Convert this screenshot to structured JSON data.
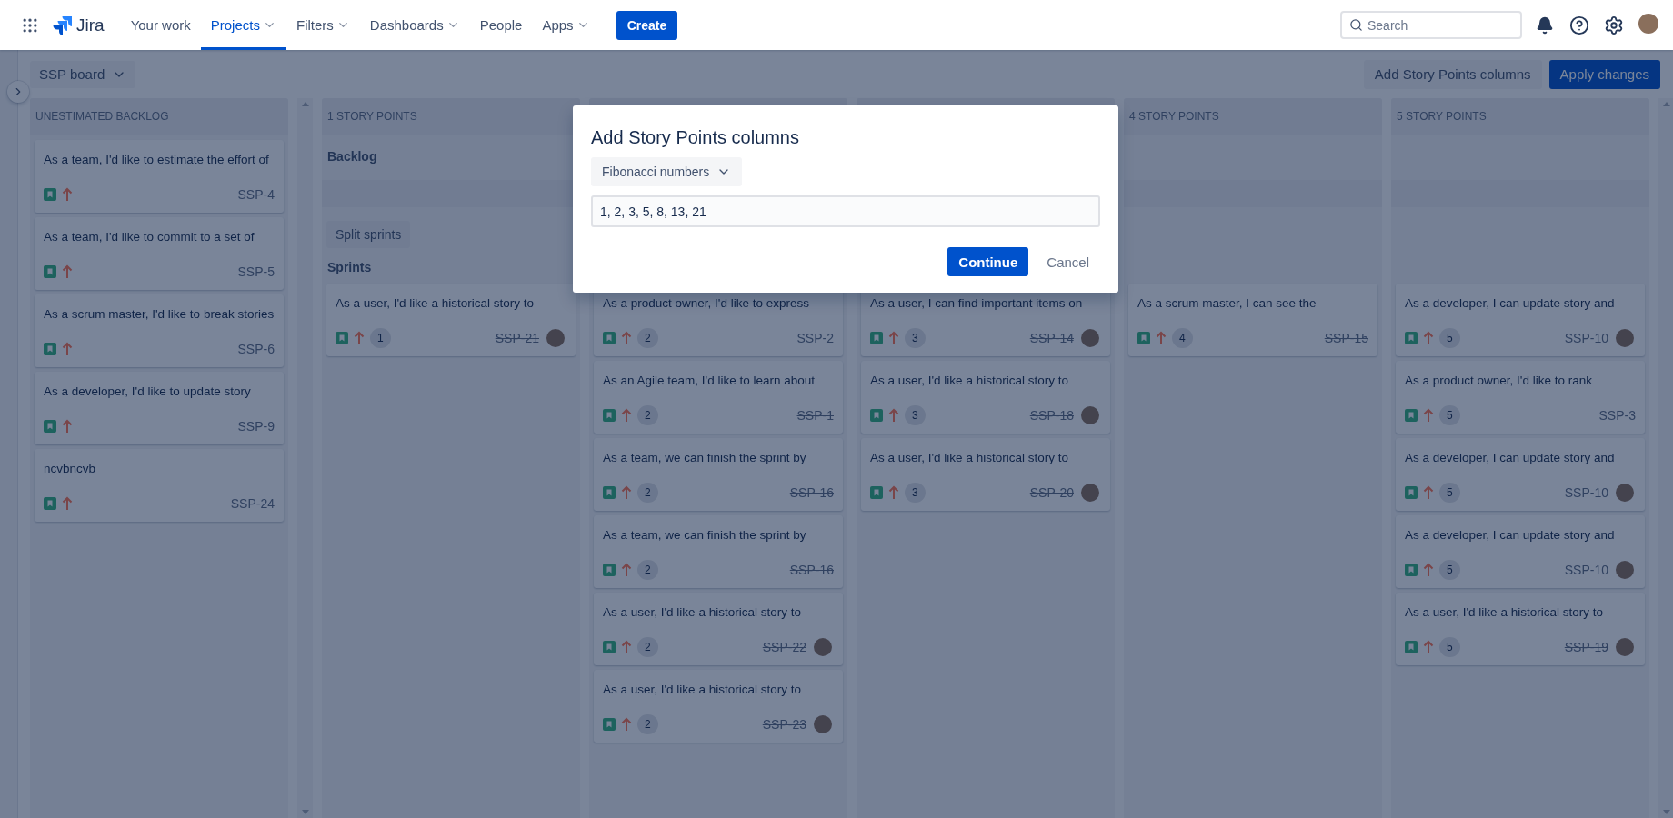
{
  "nav": {
    "items": [
      {
        "label": "Your work",
        "selected": false,
        "dropdown": false
      },
      {
        "label": "Projects",
        "selected": true,
        "dropdown": true
      },
      {
        "label": "Filters",
        "selected": false,
        "dropdown": true
      },
      {
        "label": "Dashboards",
        "selected": false,
        "dropdown": true
      },
      {
        "label": "People",
        "selected": false,
        "dropdown": false
      },
      {
        "label": "Apps",
        "selected": false,
        "dropdown": true
      }
    ],
    "logo": "Jira",
    "create": "Create",
    "search": {
      "placeholder": "Search"
    }
  },
  "board": {
    "selector": "SSP board",
    "actions": [
      {
        "label": "Add Story Points columns",
        "kind": "subtle"
      },
      {
        "label": "Apply changes",
        "kind": "primary"
      }
    ]
  },
  "columns": [
    {
      "kind": "unestimated",
      "title": "UNESTIMATED BACKLOG",
      "cards": [
        {
          "summary": "As a team, I'd like to estimate the effort of",
          "key": "SSP-4",
          "done": false,
          "assigned": false
        },
        {
          "summary": "As a team, I'd like to commit to a set of",
          "key": "SSP-5",
          "done": false,
          "assigned": false
        },
        {
          "summary": "As a scrum master, I'd like to break stories",
          "key": "SSP-6",
          "done": false,
          "assigned": false
        },
        {
          "summary": "As a developer, I'd like to update story",
          "key": "SSP-9",
          "done": false,
          "assigned": false
        },
        {
          "summary": "ncvbncvb",
          "key": "SSP-24",
          "done": false,
          "assigned": false
        }
      ]
    },
    {
      "kind": "estimated",
      "title": "1 STORY POINTS",
      "backlog_title": "Backlog",
      "split_button": "Split sprints",
      "sprints_title": "Sprints",
      "cards": [
        {
          "summary": "As a user, I'd like a historical story to",
          "key": "SSP-21",
          "points": "1",
          "done": true,
          "assigned": true
        }
      ]
    },
    {
      "kind": "estimated",
      "cards": [
        {
          "summary": "As a product owner, I'd like to express",
          "key": "SSP-2",
          "points": "2",
          "done": false,
          "assigned": false
        },
        {
          "summary": "As an Agile team, I'd like to learn about",
          "key": "SSP-1",
          "points": "2",
          "done": true,
          "assigned": false
        },
        {
          "summary": "As a team, we can finish the sprint by",
          "key": "SSP-16",
          "points": "2",
          "done": true,
          "assigned": false
        },
        {
          "summary": "As a team, we can finish the sprint by",
          "key": "SSP-16",
          "points": "2",
          "done": true,
          "assigned": false
        },
        {
          "summary": "As a user, I'd like a historical story to",
          "key": "SSP-22",
          "points": "2",
          "done": true,
          "assigned": true
        },
        {
          "summary": "As a user, I'd like a historical story to",
          "key": "SSP-23",
          "points": "2",
          "done": true,
          "assigned": true
        }
      ]
    },
    {
      "kind": "estimated",
      "cards": [
        {
          "summary": "As a user, I can find important items on",
          "key": "SSP-14",
          "points": "3",
          "done": true,
          "assigned": true
        },
        {
          "summary": "As a user, I'd like a historical story to",
          "key": "SSP-18",
          "points": "3",
          "done": true,
          "assigned": true
        },
        {
          "summary": "As a user, I'd like a historical story to",
          "key": "SSP-20",
          "points": "3",
          "done": true,
          "assigned": true
        }
      ]
    },
    {
      "kind": "estimated",
      "title": "4 STORY POINTS",
      "cards": [
        {
          "summary": "As a scrum master, I can see the",
          "key": "SSP-15",
          "points": "4",
          "done": true,
          "assigned": false
        }
      ]
    },
    {
      "kind": "estimated",
      "title": "5 STORY POINTS",
      "cards": [
        {
          "summary": "As a developer, I can update story and",
          "key": "SSP-10",
          "points": "5",
          "done": false,
          "assigned": true
        },
        {
          "summary": "As a product owner, I'd like to rank",
          "key": "SSP-3",
          "points": "5",
          "done": false,
          "assigned": false
        },
        {
          "summary": "As a developer, I can update story and",
          "key": "SSP-10",
          "points": "5",
          "done": false,
          "assigned": true
        },
        {
          "summary": "As a developer, I can update story and",
          "key": "SSP-10",
          "points": "5",
          "done": false,
          "assigned": true
        },
        {
          "summary": "As a user, I'd like a historical story to",
          "key": "SSP-19",
          "points": "5",
          "done": true,
          "assigned": true
        }
      ]
    }
  ],
  "modal": {
    "title": "Add Story Points columns",
    "select": "Fibonacci numbers",
    "input": {
      "value": "1, 2, 3, 5, 8, 13, 21"
    },
    "buttons": [
      {
        "label": "Continue",
        "kind": "primary"
      },
      {
        "label": "Cancel",
        "kind": "subtle"
      }
    ]
  }
}
